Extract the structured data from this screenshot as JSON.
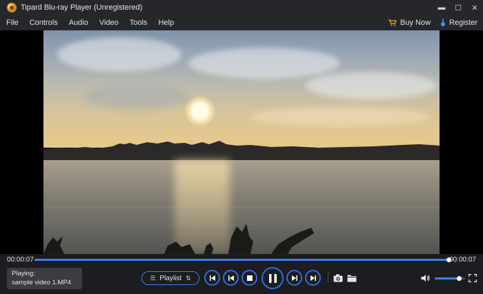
{
  "window": {
    "title": "Tipard Blu-ray Player (Unregistered)",
    "minimize": "▬",
    "maximize": "☐",
    "close": "✕"
  },
  "menu": {
    "items": [
      "File",
      "Controls",
      "Audio",
      "Video",
      "Tools",
      "Help"
    ],
    "buy_now": "Buy Now",
    "register": "Register"
  },
  "playback": {
    "current_time": "00:00:07",
    "total_time": "00:00:07",
    "progress_fraction": 1.0,
    "volume_fraction": 0.8,
    "now_playing_label": "Playing:",
    "file_name": "sample video 1.MP4",
    "playlist_label": "Playlist",
    "state": "playing"
  },
  "colors": {
    "accent": "#3f7ff0",
    "control_ring": "#2f6de0",
    "bar_bg": "#1c1d20",
    "menu_bg": "#26272b"
  },
  "icons": {
    "app": "tipard-logo-icon",
    "buy": "cart-icon",
    "register": "key-icon",
    "prev": "skip-previous-icon",
    "rewind": "rewind-icon",
    "stop": "stop-icon",
    "pause": "pause-icon",
    "forward": "fast-forward-icon",
    "next": "skip-next-icon",
    "snapshot": "camera-icon",
    "open": "folder-icon",
    "volume": "speaker-icon",
    "fullscreen": "fullscreen-icon"
  }
}
